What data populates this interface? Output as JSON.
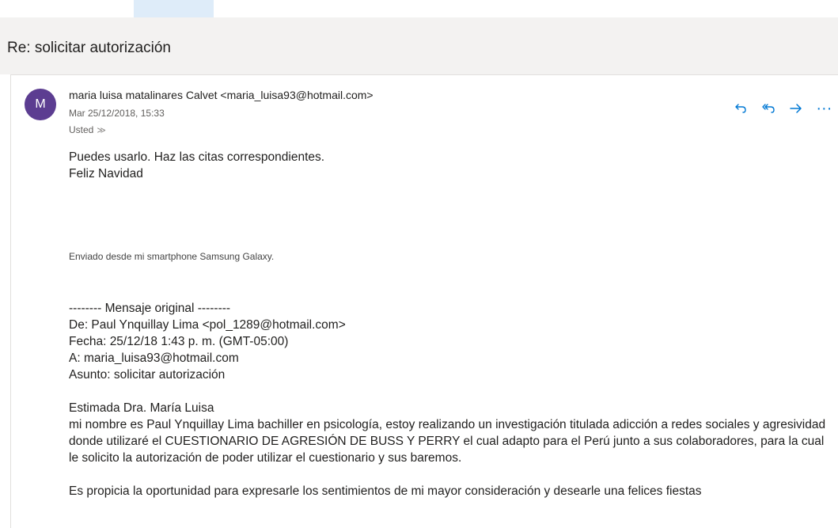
{
  "message": {
    "subject": "Re: solicitar autorización",
    "avatar_initial": "M",
    "sender": "maria luisa matalinares Calvet <maria_luisa93@hotmail.com>",
    "date": "Mar 25/12/2018, 15:33",
    "recipient": "Usted",
    "recipient_chevron": "≫"
  },
  "actions": {
    "reply_icon": "reply-icon",
    "reply_all_icon": "reply-all-icon",
    "forward_icon": "forward-icon",
    "more_icon": "more-icon",
    "more": "···"
  },
  "body": {
    "line1": "Puedes usarlo. Haz las citas correspondientes.",
    "line2": "Feliz Navidad",
    "signature": "Enviado desde mi smartphone Samsung Galaxy.",
    "orig_header": "-------- Mensaje original --------",
    "orig_from": "De: Paul Ynquillay Lima <pol_1289@hotmail.com>",
    "orig_date": "Fecha: 25/12/18 1:43 p. m. (GMT-05:00)",
    "orig_to": "A: maria_luisa93@hotmail.com",
    "orig_subject": "Asunto: solicitar autorización",
    "greeting": "Estimada Dra. María Luisa",
    "para1": "mi nombre es Paul Ynquillay Lima bachiller en psicología, estoy realizando un investigación titulada adicción a redes sociales y agresividad donde utilizaré el CUESTIONARIO DE AGRESIÓN DE BUSS Y PERRY el cual adapto para el Perú junto a sus colaboradores, para la cual le solicito la autorización de poder utilizar el cuestionario y sus baremos.",
    "para2": "Es propicia la oportunidad para expresarle los sentimientos de mi mayor consideración y desearle una felices fiestas"
  },
  "colors": {
    "accent": "#0078d4",
    "avatar": "#5c3d91",
    "header_band": "#f3f2f1"
  }
}
